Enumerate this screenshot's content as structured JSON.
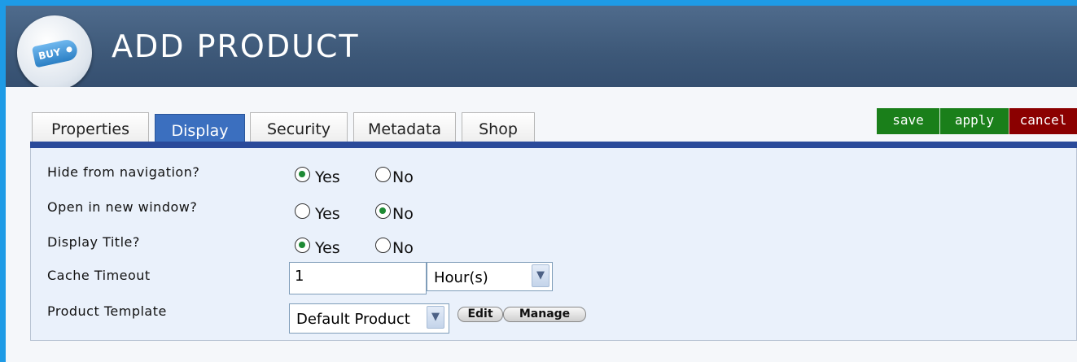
{
  "header": {
    "title": "ADD PRODUCT",
    "logo_text": "BUY"
  },
  "tabs": [
    {
      "label": "Properties",
      "active": false
    },
    {
      "label": "Display",
      "active": true
    },
    {
      "label": "Security",
      "active": false
    },
    {
      "label": "Metadata",
      "active": false
    },
    {
      "label": "Shop",
      "active": false
    }
  ],
  "actions": {
    "save_label": "save",
    "apply_label": "apply",
    "cancel_label": "cancel",
    "save_color": "#1a7f1a",
    "apply_color": "#1a7f1a",
    "cancel_color": "#8b0000"
  },
  "form": {
    "hide_nav": {
      "label": "Hide from navigation?",
      "yes": "Yes",
      "no": "No",
      "selected": "Yes"
    },
    "open_new": {
      "label": "Open in new window?",
      "yes": "Yes",
      "no": "No",
      "selected": "No"
    },
    "display_title": {
      "label": "Display Title?",
      "yes": "Yes",
      "no": "No",
      "selected": "Yes"
    },
    "cache": {
      "label": "Cache Timeout",
      "value": "1",
      "unit": "Hour(s)"
    },
    "template": {
      "label": "Product Template",
      "value": "Default Product",
      "edit_label": "Edit",
      "manage_label": "Manage"
    }
  },
  "colors": {
    "accent": "#2a4a9a",
    "active_tab": "#3b6fbf",
    "radio_checked": "#1e8a34"
  }
}
